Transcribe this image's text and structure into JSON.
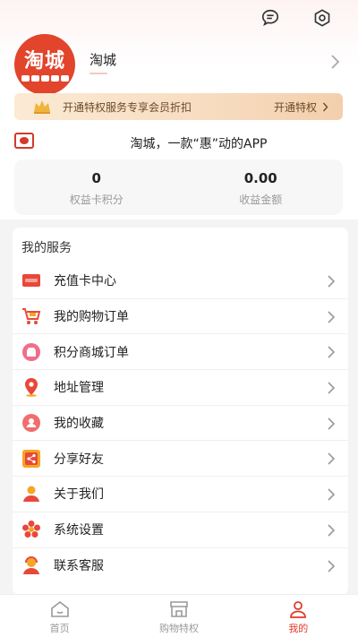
{
  "header": {
    "message_icon": "message-bubble-icon",
    "settings_icon": "settings-hex-icon"
  },
  "profile": {
    "avatar_logo_text": "淘城",
    "username": "淘城"
  },
  "vip": {
    "text": "开通特权服务专享会员折扣",
    "button_label": "开通特权"
  },
  "slogan": "淘城，一款“惠”动的APP",
  "stats": [
    {
      "value": "0",
      "label": "权益卡积分"
    },
    {
      "value": "0.00",
      "label": "收益金额"
    }
  ],
  "services": {
    "title": "我的服务",
    "items": [
      {
        "label": "充值卡中心",
        "icon": "vip-card-icon"
      },
      {
        "label": "我的购物订单",
        "icon": "shopping-cart-icon"
      },
      {
        "label": "积分商城订单",
        "icon": "points-mall-icon"
      },
      {
        "label": "地址管理",
        "icon": "location-pin-icon"
      },
      {
        "label": "我的收藏",
        "icon": "favorite-user-icon"
      },
      {
        "label": "分享好友",
        "icon": "share-icon"
      },
      {
        "label": "关于我们",
        "icon": "about-user-icon"
      },
      {
        "label": "系统设置",
        "icon": "settings-flower-icon"
      },
      {
        "label": "联系客服",
        "icon": "customer-service-icon"
      }
    ]
  },
  "tabbar": [
    {
      "label": "首页",
      "icon": "home-icon",
      "active": false
    },
    {
      "label": "购物特权",
      "icon": "shop-icon",
      "active": false
    },
    {
      "label": "我的",
      "icon": "user-icon",
      "active": true
    }
  ],
  "colors": {
    "accent": "#e23a2a",
    "vip_text": "#6b4a2a",
    "icon_red": "#e8483a",
    "icon_orange": "#f5a623"
  }
}
